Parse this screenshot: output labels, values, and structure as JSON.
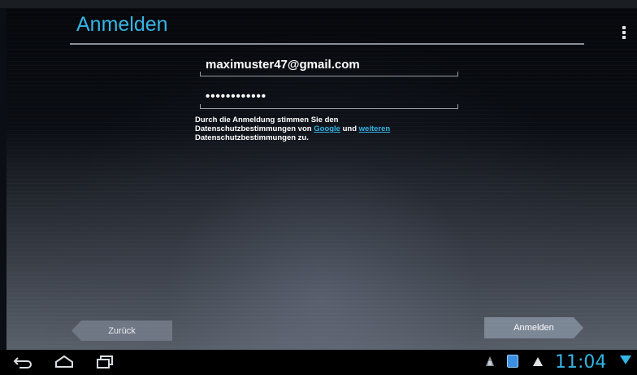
{
  "header": {
    "title": "Anmelden"
  },
  "form": {
    "email_value": "maximuster47@gmail.com",
    "password_value": "••••••••••••"
  },
  "terms": {
    "line1": "Durch die Anmeldung stimmen Sie den",
    "line2_prefix": "Datenschutzbestimmungen von ",
    "google_link": "Google",
    "and_text": " und ",
    "more_link": "weiteren",
    "line3": "Datenschutzbestimmungen zu."
  },
  "buttons": {
    "back_label": "Zurück",
    "next_label": "Anmelden"
  },
  "status_bar": {
    "time": "11:04"
  },
  "colors": {
    "accent": "#33b5e5",
    "button_gray": "#6f7784",
    "background_top": "#05070b"
  },
  "icons": {
    "nav": [
      "back-icon",
      "home-icon",
      "recent-apps-icon"
    ],
    "tray": [
      "notification-icon",
      "app-notification-icon",
      "warning-icon",
      "signal-icon"
    ],
    "menu": "overflow-menu-icon"
  }
}
